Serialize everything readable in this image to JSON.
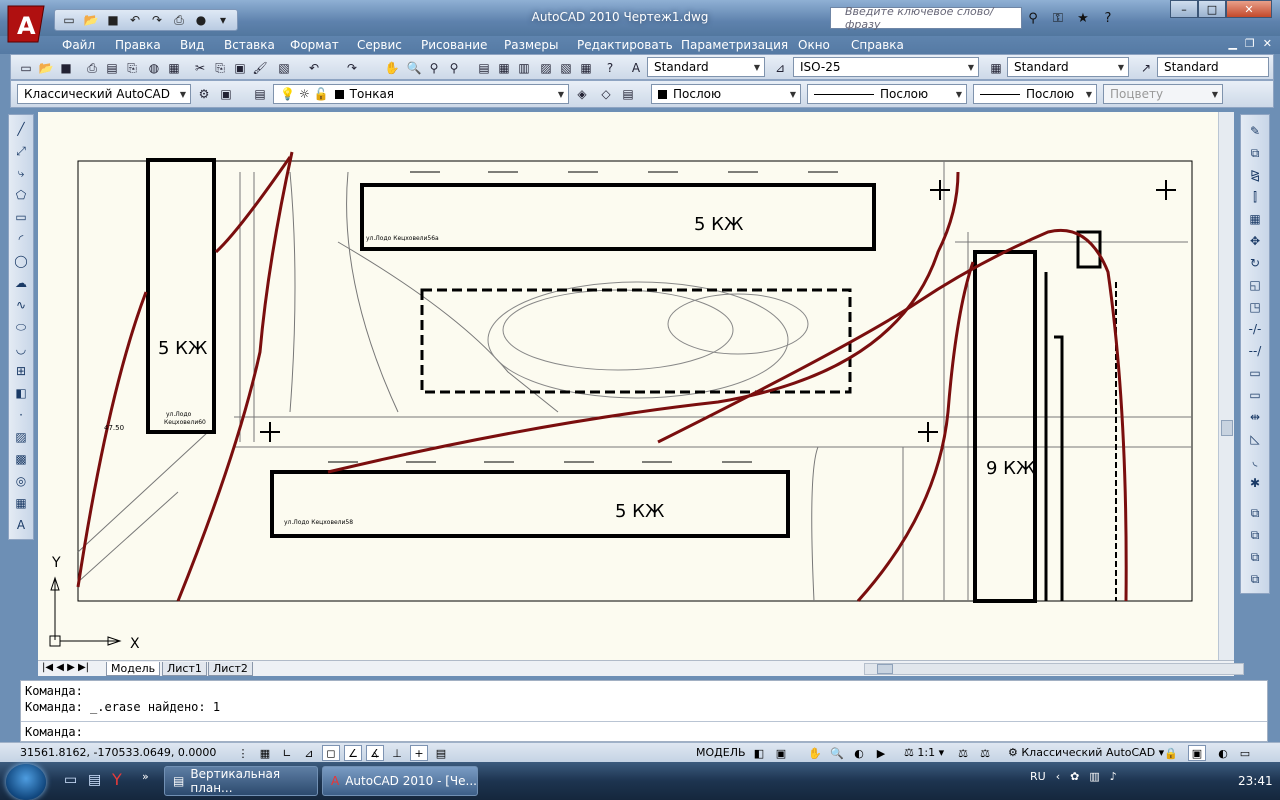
{
  "window": {
    "title": "AutoCAD 2010      Чертеж1.dwg",
    "search_placeholder": "Введите ключевое слово/фразу",
    "min": "–",
    "max": "□",
    "close": "✕"
  },
  "menu": [
    "Файл",
    "Правка",
    "Вид",
    "Вставка",
    "Формат",
    "Сервис",
    "Рисование",
    "Размеры",
    "Редактировать",
    "Параметризация",
    "Окно",
    "Справка"
  ],
  "toolbar": {
    "text_style": "Standard",
    "dim_style": "ISO-25",
    "table_style": "Standard",
    "mleader_style": "Standard",
    "workspace": "Классический AutoCAD",
    "layer": "Тонкая",
    "color": "Послою",
    "linetype": "Послою",
    "lineweight": "Послою",
    "plotstyle": "Поцвету"
  },
  "drawing": {
    "b1": "5 КЖ",
    "b2": "5 КЖ",
    "b3": "5 КЖ",
    "b4": "9 КЖ",
    "addr1a": "ул.Лодо",
    "addr1b": "Кецховели60",
    "addr2": "ул.Лодо  Кецховели56а",
    "addr3": "ул.Лодо  Кецховели58",
    "elev": "47.50",
    "ucs_x": "X",
    "ucs_y": "Y"
  },
  "tabs": [
    "Модель",
    "Лист1",
    "Лист2"
  ],
  "command": {
    "line1": "Команда:",
    "line2": "Команда:  _.erase найдено: 1",
    "prompt": "Команда:"
  },
  "status": {
    "coords": "31561.8162, -170533.0649, 0.0000",
    "model": "МОДЕЛЬ",
    "scale": "1:1",
    "workspace": "Классический AutoCAD"
  },
  "taskbar": {
    "task1": "Вертикальная план...",
    "task2": "AutoCAD 2010 - [Че...",
    "lang": "RU",
    "time": "23:41"
  }
}
